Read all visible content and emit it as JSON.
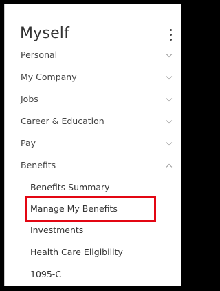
{
  "panel": {
    "title": "Myself"
  },
  "menu": {
    "items": [
      {
        "label": "Personal",
        "expanded": false
      },
      {
        "label": "My Company",
        "expanded": false
      },
      {
        "label": "Jobs",
        "expanded": false
      },
      {
        "label": "Career & Education",
        "expanded": false
      },
      {
        "label": "Pay",
        "expanded": false
      },
      {
        "label": "Benefits",
        "expanded": true
      }
    ],
    "benefits_submenu": [
      {
        "label": "Benefits Summary"
      },
      {
        "label": "Manage My Benefits"
      },
      {
        "label": "Investments"
      },
      {
        "label": "Health Care Eligibility"
      },
      {
        "label": "1095-C"
      }
    ]
  },
  "colors": {
    "outer_border": "#000000",
    "highlight": "#e30613",
    "text": "#444444"
  },
  "icons": {
    "more_options": "more-vertical-icon",
    "collapsed": "chevron-down-icon",
    "expanded": "chevron-up-icon"
  }
}
